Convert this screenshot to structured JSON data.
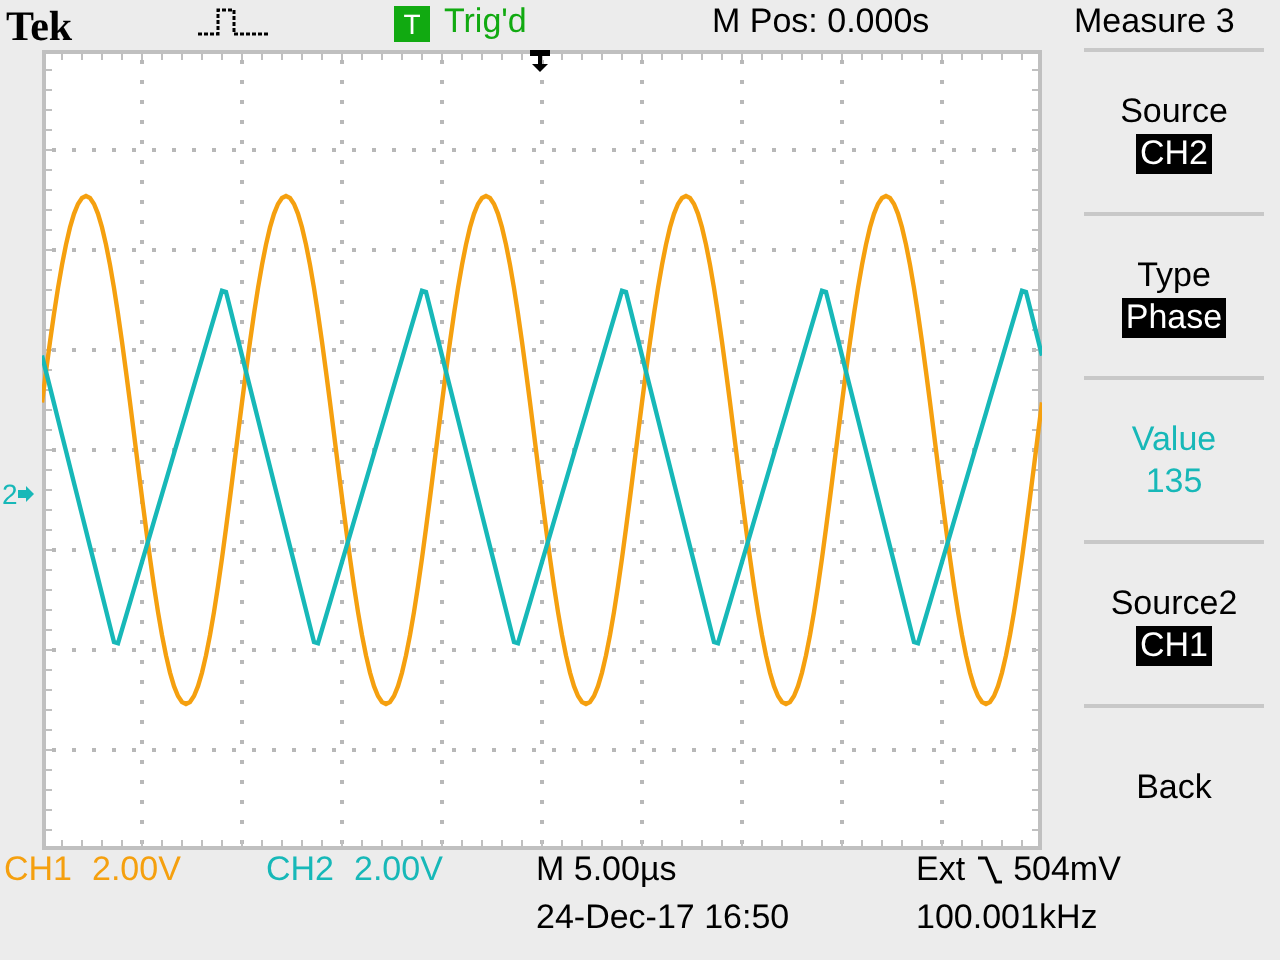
{
  "header": {
    "logo": "Tek",
    "trigger_badge": "T",
    "trigger_status": "Trig'd",
    "position": "M Pos: 0.000s",
    "menu_title": "Measure 3"
  },
  "screen": {
    "channel_marker": "2"
  },
  "menu": [
    {
      "kind": "selector",
      "label": "Source",
      "value": "CH2"
    },
    {
      "kind": "selector",
      "label": "Type",
      "value": "Phase"
    },
    {
      "kind": "reading",
      "label": "Value",
      "value": "135"
    },
    {
      "kind": "selector",
      "label": "Source2",
      "value": "CH1"
    },
    {
      "kind": "action",
      "label": "Back"
    }
  ],
  "channels": [
    {
      "name": "CH1",
      "scale": "2.00V",
      "color": "#f5a00f"
    },
    {
      "name": "CH2",
      "scale": "2.00V",
      "color": "#17b8b8"
    }
  ],
  "timebase": "M 5.00µs",
  "date": "24-Dec-17 16:50",
  "trigger": {
    "source": "Ext",
    "level": "504mV",
    "frequency": "100.001kHz"
  }
}
